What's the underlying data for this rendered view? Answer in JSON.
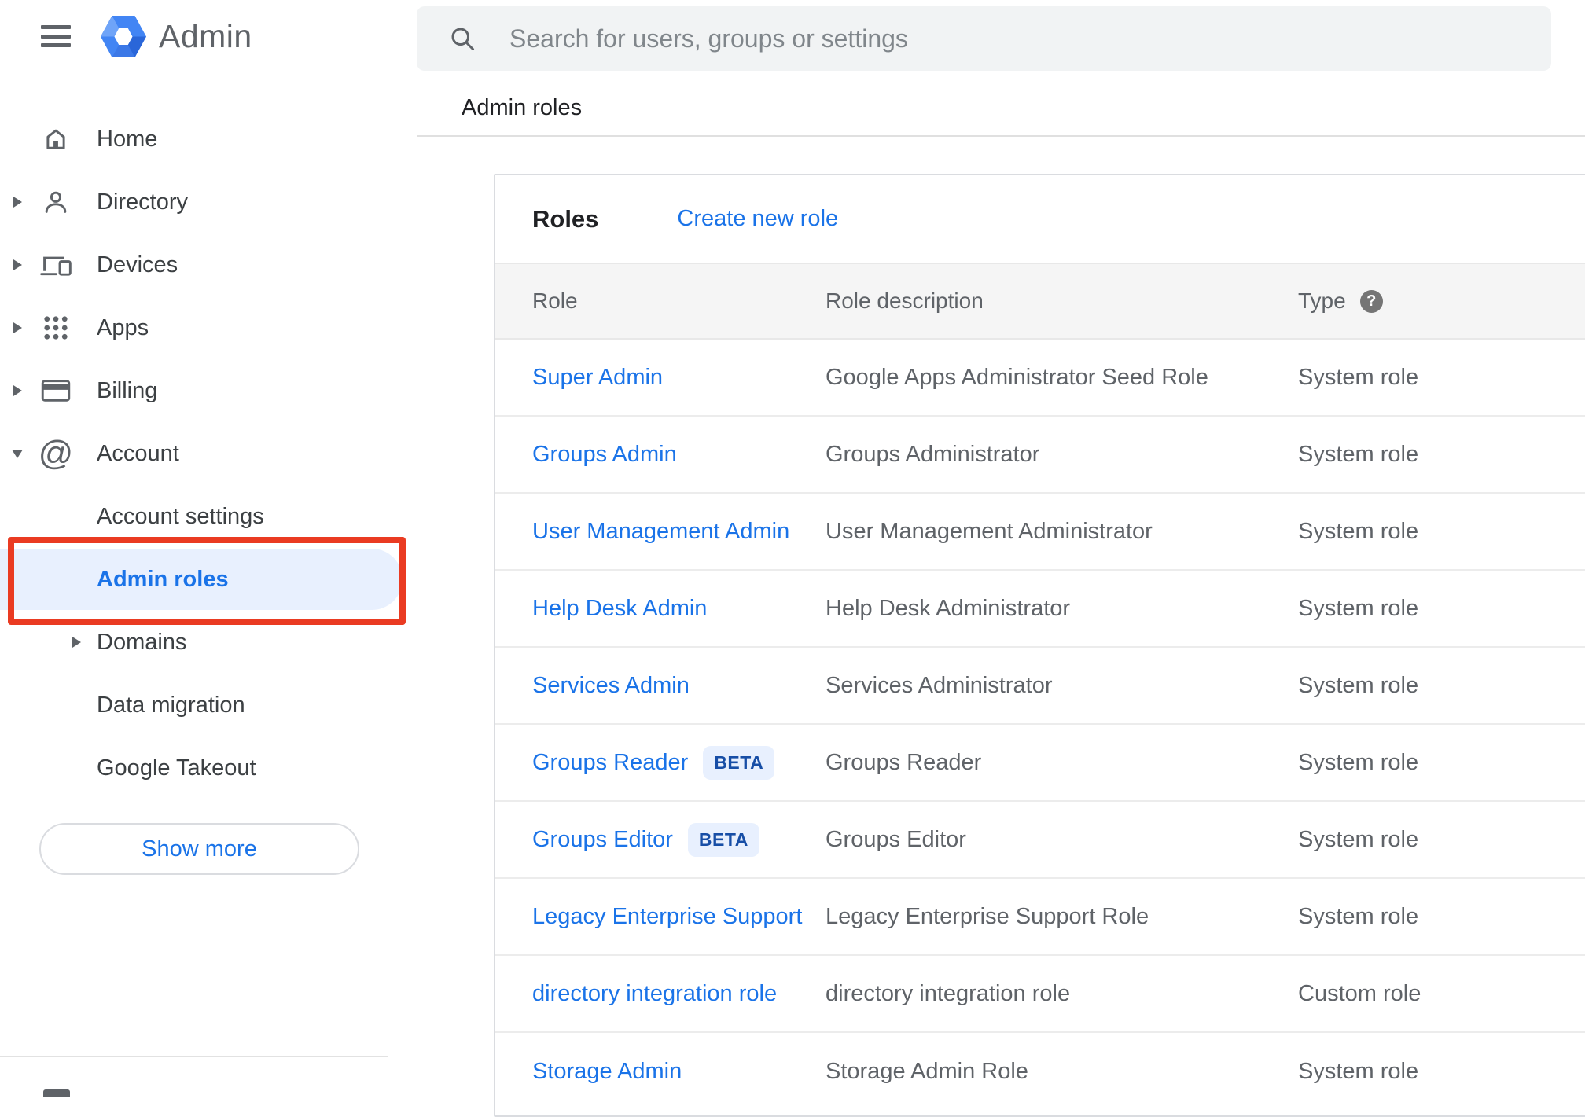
{
  "brand": {
    "product_name": "Admin"
  },
  "search": {
    "placeholder": "Search for users, groups or settings"
  },
  "breadcrumb": {
    "label": "Admin roles"
  },
  "sidebar": {
    "items": [
      {
        "id": "home",
        "label": "Home",
        "icon": "home-icon",
        "caret": null,
        "sub": false,
        "selected": false
      },
      {
        "id": "directory",
        "label": "Directory",
        "icon": "person-icon",
        "caret": "right",
        "sub": false,
        "selected": false
      },
      {
        "id": "devices",
        "label": "Devices",
        "icon": "devices-icon",
        "caret": "right",
        "sub": false,
        "selected": false
      },
      {
        "id": "apps",
        "label": "Apps",
        "icon": "apps-grid-icon",
        "caret": "right",
        "sub": false,
        "selected": false
      },
      {
        "id": "billing",
        "label": "Billing",
        "icon": "card-icon",
        "caret": "right",
        "sub": false,
        "selected": false
      },
      {
        "id": "account",
        "label": "Account",
        "icon": "at-icon",
        "caret": "down",
        "sub": false,
        "selected": false
      },
      {
        "id": "account-settings",
        "label": "Account settings",
        "icon": null,
        "caret": null,
        "sub": true,
        "selected": false
      },
      {
        "id": "admin-roles",
        "label": "Admin roles",
        "icon": null,
        "caret": null,
        "sub": true,
        "selected": true
      },
      {
        "id": "domains",
        "label": "Domains",
        "icon": null,
        "caret": "right",
        "sub": true,
        "selected": false
      },
      {
        "id": "data-migration",
        "label": "Data migration",
        "icon": null,
        "caret": null,
        "sub": true,
        "selected": false
      },
      {
        "id": "google-takeout",
        "label": "Google Takeout",
        "icon": null,
        "caret": null,
        "sub": true,
        "selected": false
      }
    ],
    "show_more_label": "Show more"
  },
  "roles_card": {
    "title": "Roles",
    "create_link_label": "Create new role",
    "columns": {
      "role": "Role",
      "description": "Role description",
      "type": "Type"
    },
    "beta_label": "BETA",
    "rows": [
      {
        "role": "Super Admin",
        "beta": false,
        "description": "Google Apps Administrator Seed Role",
        "type": "System role"
      },
      {
        "role": "Groups Admin",
        "beta": false,
        "description": "Groups Administrator",
        "type": "System role"
      },
      {
        "role": "User Management Admin",
        "beta": false,
        "description": "User Management Administrator",
        "type": "System role"
      },
      {
        "role": "Help Desk Admin",
        "beta": false,
        "description": "Help Desk Administrator",
        "type": "System role"
      },
      {
        "role": "Services Admin",
        "beta": false,
        "description": "Services Administrator",
        "type": "System role"
      },
      {
        "role": "Groups Reader",
        "beta": true,
        "description": "Groups Reader",
        "type": "System role"
      },
      {
        "role": "Groups Editor",
        "beta": true,
        "description": "Groups Editor",
        "type": "System role"
      },
      {
        "role": "Legacy Enterprise Support",
        "beta": false,
        "description": "Legacy Enterprise Support Role",
        "type": "System role"
      },
      {
        "role": "directory integration role",
        "beta": false,
        "description": "directory integration role",
        "type": "Custom role"
      },
      {
        "role": "Storage Admin",
        "beta": false,
        "description": "Storage Admin Role",
        "type": "System role"
      }
    ]
  },
  "colors": {
    "accent_blue": "#1a73e8",
    "selected_pill_bg": "#e8f0fe",
    "annotation_red": "#ea3b22",
    "beta_badge_text": "#174ea6",
    "table_header_bg": "#f5f5f5",
    "searchbar_bg": "#f1f3f4",
    "text_primary": "#202124",
    "text_secondary": "#5f6368"
  }
}
